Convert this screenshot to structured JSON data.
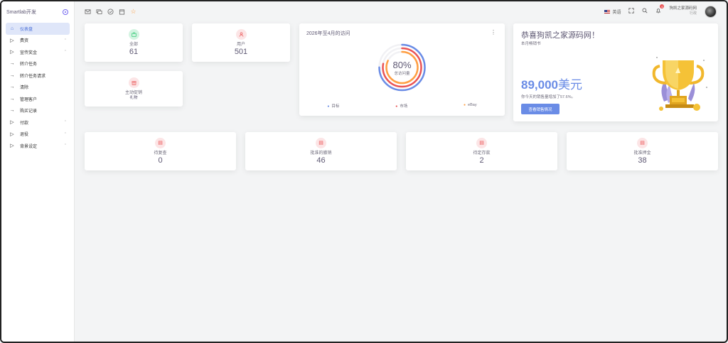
{
  "sidebar": {
    "brand": "Smartlab开发",
    "items": [
      {
        "label": "仪表盘",
        "icon": "home-icon",
        "chevron": false,
        "active": true
      },
      {
        "label": "费资",
        "icon": "play-icon",
        "chevron": true
      },
      {
        "label": "宣传奖金",
        "icon": "play-icon",
        "chevron": true
      },
      {
        "label": "转介任务",
        "icon": "arrow-right-icon",
        "chevron": false
      },
      {
        "label": "转介任务请求",
        "icon": "arrow-right-icon",
        "chevron": false
      },
      {
        "label": "清除",
        "icon": "arrow-right-icon",
        "chevron": false
      },
      {
        "label": "管理客户",
        "icon": "arrow-right-icon",
        "chevron": false
      },
      {
        "label": "购买记录",
        "icon": "arrow-right-icon",
        "chevron": false
      },
      {
        "label": "付款",
        "icon": "play-icon",
        "chevron": true
      },
      {
        "label": "退役",
        "icon": "play-icon",
        "chevron": true
      },
      {
        "label": "背景设定",
        "icon": "play-icon",
        "chevron": true
      }
    ]
  },
  "topbar": {
    "language": "英语",
    "notification_count": "6",
    "user_name": "狗凯之家源码网",
    "user_role": "行政"
  },
  "stats_top": [
    {
      "label": "全部",
      "value": "61",
      "color": "green"
    },
    {
      "label": "用户",
      "value": "501",
      "color": "red"
    }
  ],
  "stat_promo": {
    "label": "主动促销",
    "value": "礼物"
  },
  "chart": {
    "title": "2026年至4月的访问",
    "center_value": "80%",
    "center_label": "总访问量",
    "legend": [
      "目标",
      "市场",
      "eBay"
    ]
  },
  "chart_data": {
    "type": "radialBar",
    "title": "2026年至4月的访问",
    "series": [
      {
        "name": "目标",
        "color": "#6a8ce6",
        "fraction": 0.75
      },
      {
        "name": "市场",
        "color": "#ea5455",
        "fraction": 0.78
      },
      {
        "name": "eBay",
        "color": "#ff9f43",
        "fraction": 0.82
      }
    ],
    "center_value": "80%"
  },
  "congrats": {
    "title": "恭喜狗凯之家源码网！",
    "subtitle": "本月畅销书",
    "amount": "89,000",
    "unit": "美元",
    "note": "你今天的销售量增加了57.6%。",
    "button": "查看销售情况"
  },
  "stats_bottom": [
    {
      "label": "待复查",
      "value": "0"
    },
    {
      "label": "批准的撤销",
      "value": "46"
    },
    {
      "label": "待定存款",
      "value": "2"
    },
    {
      "label": "批准押金",
      "value": "38"
    }
  ]
}
